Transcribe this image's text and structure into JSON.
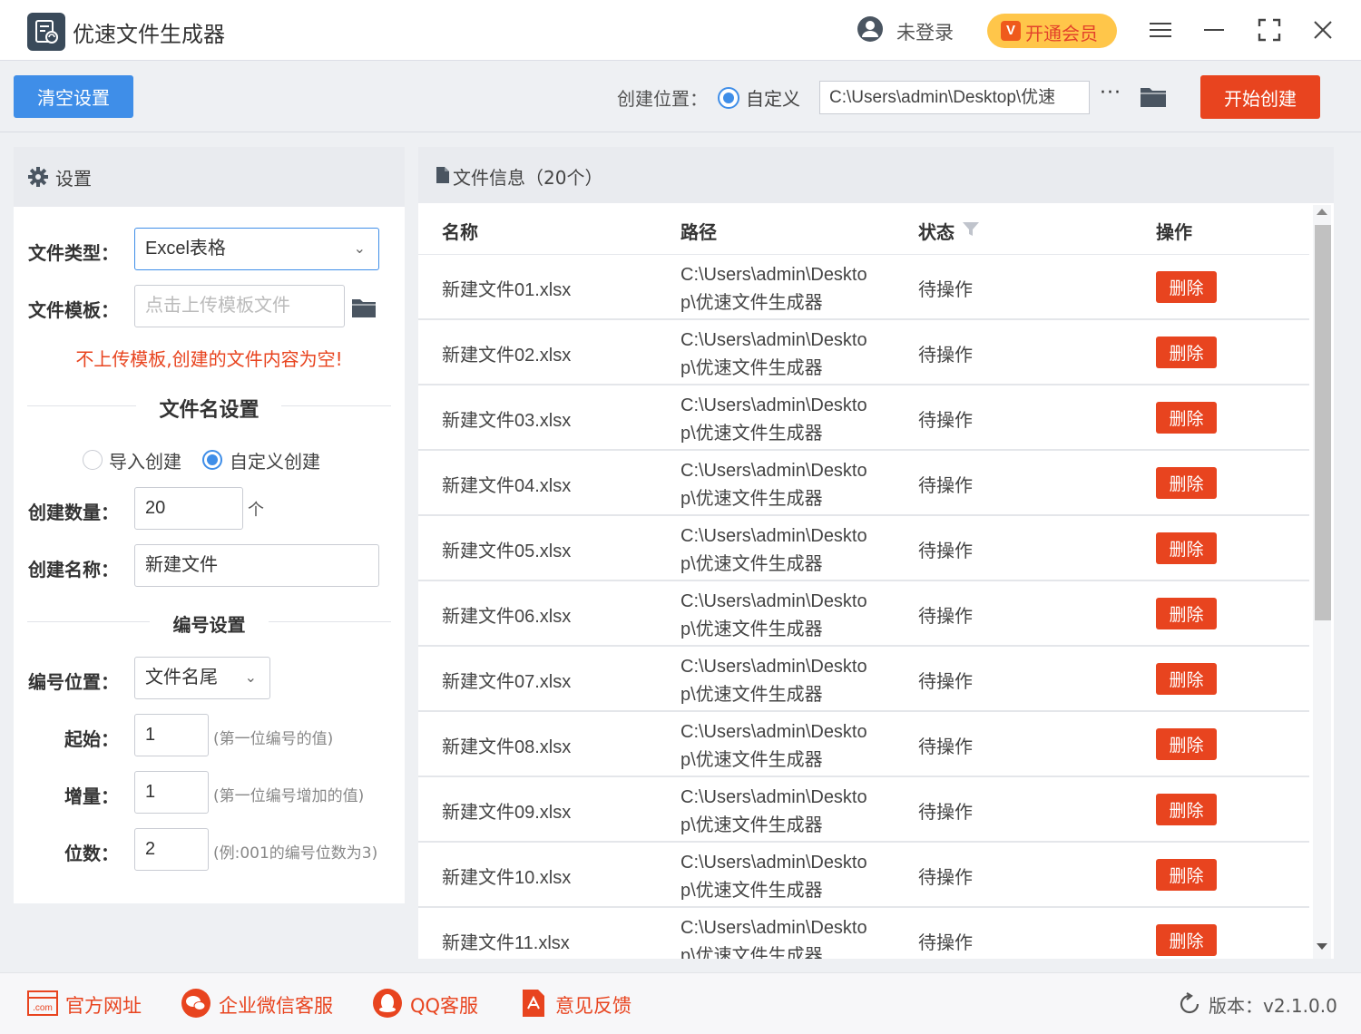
{
  "app": {
    "title": "优速文件生成器"
  },
  "header": {
    "login": "未登录",
    "vip": "开通会员",
    "vip_badge": "V"
  },
  "toolbar": {
    "clear": "清空设置",
    "location_label": "创建位置：",
    "location_option": "自定义",
    "path": "C:\\Users\\admin\\Desktop\\优速",
    "more": "···",
    "start": "开始创建"
  },
  "settings": {
    "title": "设置",
    "file_type_label": "文件类型：",
    "file_type_value": "Excel表格",
    "template_label": "文件模板：",
    "template_placeholder": "点击上传模板文件",
    "warning": "不上传模板,创建的文件内容为空!",
    "name_section": "文件名设置",
    "mode_import": "导入创建",
    "mode_custom": "自定义创建",
    "count_label": "创建数量：",
    "count_value": "20",
    "count_unit": "个",
    "name_label": "创建名称：",
    "name_value": "新建文件",
    "numbering_section": "编号设置",
    "position_label": "编号位置：",
    "position_value": "文件名尾",
    "start_label": "起始：",
    "start_value": "1",
    "start_hint": "(第一位编号的值)",
    "step_label": "增量：",
    "step_value": "1",
    "step_hint": "(第一位编号增加的值)",
    "digits_label": "位数：",
    "digits_value": "2",
    "digits_hint": "(例:001的编号位数为3)"
  },
  "file_info": {
    "title": "文件信息（20个）",
    "columns": {
      "name": "名称",
      "path": "路径",
      "status": "状态",
      "action": "操作"
    },
    "rows": [
      {
        "name": "新建文件01.xlsx",
        "path": "C:\\Users\\admin\\Desktop\\优速文件生成器",
        "status": "待操作",
        "action": "删除"
      },
      {
        "name": "新建文件02.xlsx",
        "path": "C:\\Users\\admin\\Desktop\\优速文件生成器",
        "status": "待操作",
        "action": "删除"
      },
      {
        "name": "新建文件03.xlsx",
        "path": "C:\\Users\\admin\\Desktop\\优速文件生成器",
        "status": "待操作",
        "action": "删除"
      },
      {
        "name": "新建文件04.xlsx",
        "path": "C:\\Users\\admin\\Desktop\\优速文件生成器",
        "status": "待操作",
        "action": "删除"
      },
      {
        "name": "新建文件05.xlsx",
        "path": "C:\\Users\\admin\\Desktop\\优速文件生成器",
        "status": "待操作",
        "action": "删除"
      },
      {
        "name": "新建文件06.xlsx",
        "path": "C:\\Users\\admin\\Desktop\\优速文件生成器",
        "status": "待操作",
        "action": "删除"
      },
      {
        "name": "新建文件07.xlsx",
        "path": "C:\\Users\\admin\\Desktop\\优速文件生成器",
        "status": "待操作",
        "action": "删除"
      },
      {
        "name": "新建文件08.xlsx",
        "path": "C:\\Users\\admin\\Desktop\\优速文件生成器",
        "status": "待操作",
        "action": "删除"
      },
      {
        "name": "新建文件09.xlsx",
        "path": "C:\\Users\\admin\\Desktop\\优速文件生成器",
        "status": "待操作",
        "action": "删除"
      },
      {
        "name": "新建文件10.xlsx",
        "path": "C:\\Users\\admin\\Desktop\\优速文件生成器",
        "status": "待操作",
        "action": "删除"
      },
      {
        "name": "新建文件11.xlsx",
        "path": "C:\\Users\\admin\\Desktop\\优速文件生成器",
        "status": "待操作",
        "action": "删除"
      }
    ]
  },
  "footer": {
    "website": "官方网址",
    "website_icon_text": ".com",
    "wechat": "企业微信客服",
    "qq": "QQ客服",
    "feedback": "意见反馈",
    "version": "版本：v2.1.0.0"
  },
  "colors": {
    "primary": "#3f8ee8",
    "danger": "#e8441f",
    "vip": "#ffc64a"
  }
}
